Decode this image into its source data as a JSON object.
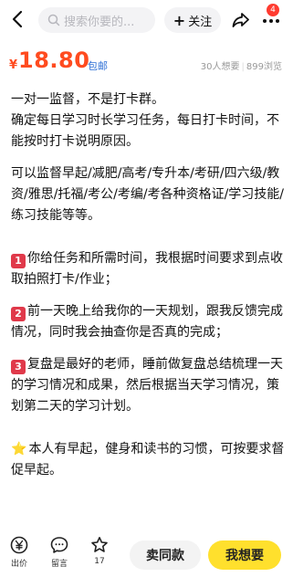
{
  "header": {
    "search_placeholder": "搜索你要的...",
    "follow_label": "关注",
    "follow_plus": "+",
    "notification_count": "4"
  },
  "price": {
    "currency": "¥",
    "amount": "18.80",
    "shipping": "包邮",
    "wants": "30人想要",
    "views": "899浏览"
  },
  "description": {
    "line1": "一对一监督，不是打卡群。",
    "line2": "确定每日学习时长学习任务，每日打卡时间，不能按时打卡说明原因。",
    "line3": "可以监督早起/减肥/高考/专升本/考研/四六级/教资/雅思/托福/考公/考编/考各种资格证/学习技能/练习技能等等。",
    "item1_num": "1",
    "item1": "你给任务和所需时间，我根据时间要求到点收取拍照打卡/作业；",
    "item2_num": "2",
    "item2": "前一天晚上给我你的一天规划，跟我反馈完成情况，同时我会抽查你是否真的完成；",
    "item3_num": "3",
    "item3": "复盘是最好的老师，睡前做复盘总结梳理一天的学习情况和成果，然后根据当天学习情况，策划第二天的学习计划。",
    "note_star": "⭐",
    "note": "本人有早起，健身和读书的习惯，可按要求督促早起。"
  },
  "bottom": {
    "offer_label": "出价",
    "message_label": "留言",
    "fav_count": "17",
    "similar_label": "卖同款",
    "want_label": "我想要"
  },
  "colors": {
    "price": "#ff4b1f",
    "shipping": "#2d6fd6",
    "want_button": "#ffe02d",
    "badge": "#ff3b30",
    "number_badge": "#e0394a"
  }
}
